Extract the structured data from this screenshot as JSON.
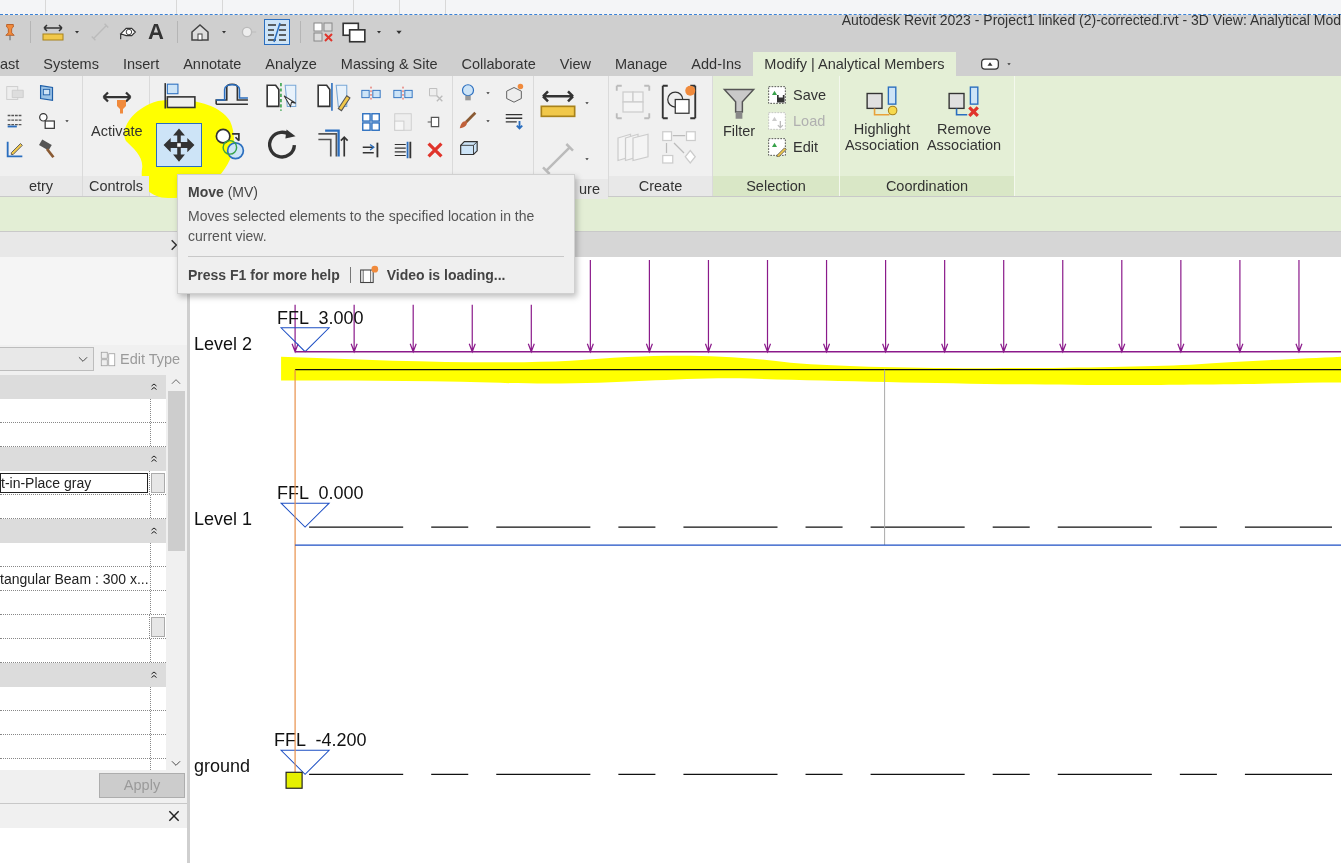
{
  "window": {
    "title": "Autodesk Revit 2023 - Project1 linked (2)-corrected.rvt - 3D View: Analytical Mod"
  },
  "quick_access": {
    "text_tool": "A"
  },
  "tabs": [
    {
      "label": "ast",
      "selected": false
    },
    {
      "label": "Systems",
      "selected": false
    },
    {
      "label": "Insert",
      "selected": false
    },
    {
      "label": "Annotate",
      "selected": false
    },
    {
      "label": "Analyze",
      "selected": false
    },
    {
      "label": "Massing & Site",
      "selected": false
    },
    {
      "label": "Collaborate",
      "selected": false
    },
    {
      "label": "View",
      "selected": false
    },
    {
      "label": "Manage",
      "selected": false
    },
    {
      "label": "Add-Ins",
      "selected": false
    },
    {
      "label": "Modify | Analytical Members",
      "selected": true
    }
  ],
  "ribbon": {
    "panels": [
      {
        "kind": "geometry",
        "label": "etry",
        "contextual": false
      },
      {
        "kind": "controls",
        "label": "Controls",
        "contextual": false,
        "buttons": [
          {
            "label": "Activate",
            "disabled": false
          }
        ]
      },
      {
        "kind": "modify",
        "contextual": false,
        "buttons": [
          {
            "selected": true
          }
        ]
      },
      {
        "kind": "view",
        "contextual": false
      },
      {
        "kind": "measure",
        "label": "ure",
        "contextual": false
      },
      {
        "kind": "create",
        "label": "Create",
        "contextual": false
      },
      {
        "kind": "selection",
        "label": "Selection",
        "contextual": true,
        "buttons": [
          {
            "label": "Filter",
            "disabled": false
          },
          {
            "label": "Save",
            "disabled": false
          },
          {
            "label": "Load",
            "disabled": true
          },
          {
            "label": "Edit",
            "disabled": false
          }
        ]
      },
      {
        "kind": "coordination",
        "label": "Coordination",
        "contextual": true,
        "buttons": [
          {
            "label": "Highlight Association",
            "disabled": false
          },
          {
            "label": "Remove Association",
            "disabled": false
          }
        ]
      }
    ]
  },
  "tooltip": {
    "title": "Move",
    "shortcut": "(MV)",
    "description": "Moves selected elements to the specified location in the current view.",
    "help": "Press F1 for more help",
    "video": "Video is loading..."
  },
  "properties": {
    "edit_type": {
      "label": "Edit Type",
      "disabled": true
    },
    "groups": [
      {
        "rows": [
          {
            "kind": "blank"
          },
          {
            "kind": "blank"
          }
        ]
      },
      {
        "rows": [
          {
            "kind": "field",
            "value": "t-in-Place gray"
          },
          {
            "kind": "blank"
          }
        ]
      },
      {
        "rows": [
          {
            "kind": "blank"
          },
          {
            "kind": "text",
            "value": "tangular Beam : 300 x..."
          },
          {
            "kind": "blank"
          },
          {
            "kind": "button"
          },
          {
            "kind": "blank"
          }
        ]
      },
      {
        "rows": [
          {
            "kind": "blank"
          },
          {
            "kind": "blank"
          },
          {
            "kind": "blank"
          },
          {
            "kind": "blank"
          }
        ]
      }
    ],
    "apply": {
      "label": "Apply",
      "disabled": true
    }
  },
  "view": {
    "levels": [
      {
        "name": "Level 2",
        "elevation": "FFL  3.000"
      },
      {
        "name": "Level 1",
        "elevation": "FFL  0.000"
      },
      {
        "name": "ground",
        "elevation": "FFL  -4.200"
      }
    ]
  }
}
